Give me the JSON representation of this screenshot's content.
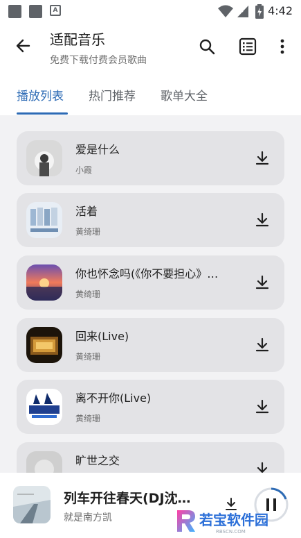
{
  "status_bar": {
    "time": "4:42"
  },
  "header": {
    "title": "适配音乐",
    "subtitle": "免费下载付费会员歌曲"
  },
  "tabs": [
    {
      "label": "播放列表",
      "active": true
    },
    {
      "label": "热门推荐",
      "active": false
    },
    {
      "label": "歌单大全",
      "active": false
    }
  ],
  "songs": [
    {
      "title": "爱是什么",
      "artist": "小霞"
    },
    {
      "title": "活着",
      "artist": "黄绮珊"
    },
    {
      "title": "你也怀念吗(《你不要担心》…",
      "artist": "黄绮珊"
    },
    {
      "title": "回来(Live)",
      "artist": "黄绮珊"
    },
    {
      "title": "离不开你(Live)",
      "artist": "黄绮珊"
    },
    {
      "title": "旷世之交",
      "artist": ""
    }
  ],
  "player": {
    "title": "列车开往春天(DJ沈…",
    "artist": "就是南方凯"
  },
  "watermark": {
    "text": "若宝软件园",
    "sub": "RBSCN.COM"
  },
  "colors": {
    "accent": "#2d6bb5",
    "card": "#e3e3e6",
    "list_bg": "#f2f2f4"
  }
}
